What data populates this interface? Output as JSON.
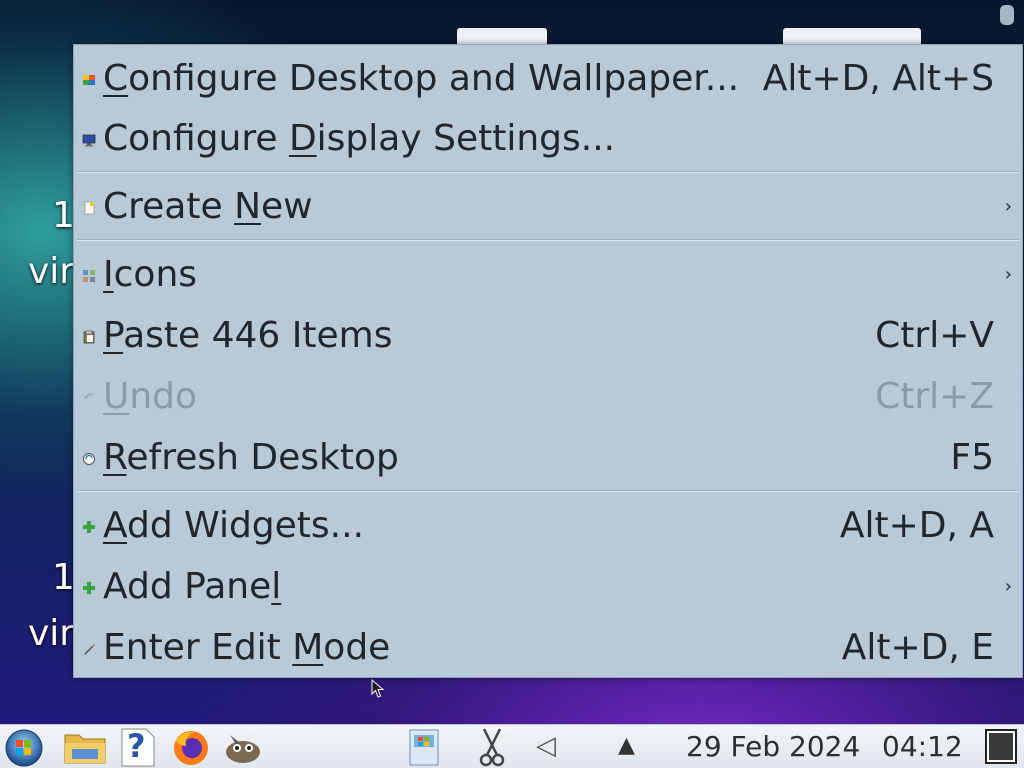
{
  "desktop": {
    "labels": [
      "1",
      "vir",
      "1",
      "vir"
    ]
  },
  "menu": {
    "items": [
      {
        "label_pre": "",
        "label_key": "C",
        "label_post": "onfigure Desktop and Wallpaper...",
        "shortcut": "Alt+D, Alt+S",
        "icon": "desktop-wallpaper-icon"
      },
      {
        "label_pre": "Configure ",
        "label_key": "D",
        "label_post": "isplay Settings...",
        "shortcut": "",
        "icon": "display-icon"
      },
      {
        "label_pre": "Create ",
        "label_key": "N",
        "label_post": "ew",
        "shortcut": "",
        "icon": "new-document-icon",
        "submenu": "›"
      },
      {
        "label_pre": "",
        "label_key": "I",
        "label_post": "cons",
        "shortcut": "",
        "icon": "icons-grid-icon",
        "submenu": "›"
      },
      {
        "label_pre": "",
        "label_key": "P",
        "label_post": "aste 446 Items",
        "shortcut": "Ctrl+V",
        "icon": "paste-icon"
      },
      {
        "label_pre": "",
        "label_key": "U",
        "label_post": "ndo",
        "shortcut": "Ctrl+Z",
        "icon": "undo-icon",
        "disabled": true
      },
      {
        "label_pre": "",
        "label_key": "R",
        "label_post": "efresh Desktop",
        "shortcut": "F5",
        "icon": "refresh-icon"
      },
      {
        "label_pre": "",
        "label_key": "A",
        "label_post": "dd Widgets...",
        "shortcut": "Alt+D, A",
        "icon": "add-icon"
      },
      {
        "label_pre": "Add Pane",
        "label_key": "l",
        "label_post": "",
        "shortcut": "",
        "icon": "add-icon",
        "submenu": "›"
      },
      {
        "label_pre": "Enter Edit ",
        "label_key": "M",
        "label_post": "ode",
        "shortcut": "Alt+D, E",
        "icon": "edit-pen-icon"
      }
    ]
  },
  "taskbar": {
    "date": "29 Feb 2024",
    "time": "04:12",
    "help_glyph": "?",
    "volume_glyph": "◁",
    "tray_expand_glyph": "▲",
    "icons": [
      "start-orb-icon",
      "file-manager-icon",
      "help-icon",
      "firefox-icon",
      "gimp-icon",
      "document-icon",
      "scissors-icon",
      "volume-icon",
      "tray-expand-icon",
      "show-desktop-icon"
    ]
  },
  "colors": {
    "menu_bg": "#b8c9d8",
    "menu_text": "#20262c",
    "menu_disabled": "#8c9aa7",
    "add_green": "#3aa23a"
  }
}
